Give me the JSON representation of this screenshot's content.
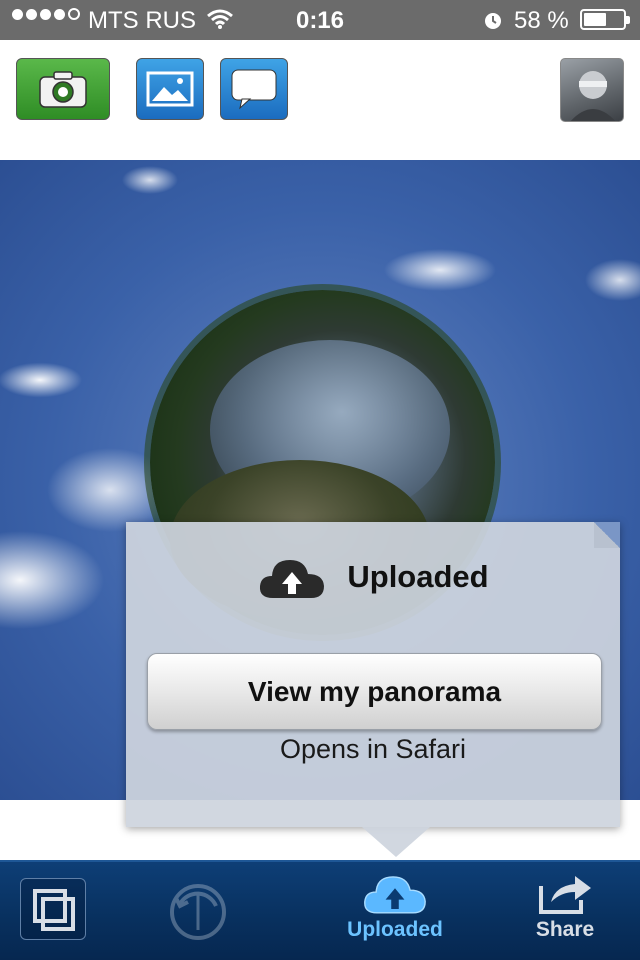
{
  "status_bar": {
    "carrier": "MTS RUS",
    "time": "0:16",
    "battery_percent": "58 %",
    "battery_level": 0.58,
    "signal_bars": 4,
    "icons": [
      "signal-dots-icon",
      "wifi-icon",
      "alarm-icon",
      "battery-icon"
    ]
  },
  "toolbar": {
    "buttons": [
      {
        "name": "camera-button",
        "icon": "camera-icon",
        "color": "#3a9b2e"
      },
      {
        "name": "gallery-button",
        "icon": "image-icon",
        "color": "#2b82d4"
      },
      {
        "name": "chat-button",
        "icon": "speech-bubble-icon",
        "color": "#2b82d4"
      }
    ],
    "avatar": "user-avatar"
  },
  "popover": {
    "title": "Uploaded",
    "icon": "cloud-upload-icon",
    "button_label": "View my panorama",
    "note": "Opens in Safari"
  },
  "tab_bar": {
    "tabs": [
      {
        "name": "tab-stack",
        "icon": "stack-icon",
        "label": ""
      },
      {
        "name": "tab-rotate",
        "icon": "rotate-icon",
        "label": "",
        "disabled": true
      },
      {
        "name": "tab-uploaded",
        "icon": "cloud-upload-icon",
        "label": "Uploaded",
        "active": true
      },
      {
        "name": "tab-share",
        "icon": "share-icon",
        "label": "Share"
      }
    ],
    "active_color": "#6cc3ff"
  }
}
